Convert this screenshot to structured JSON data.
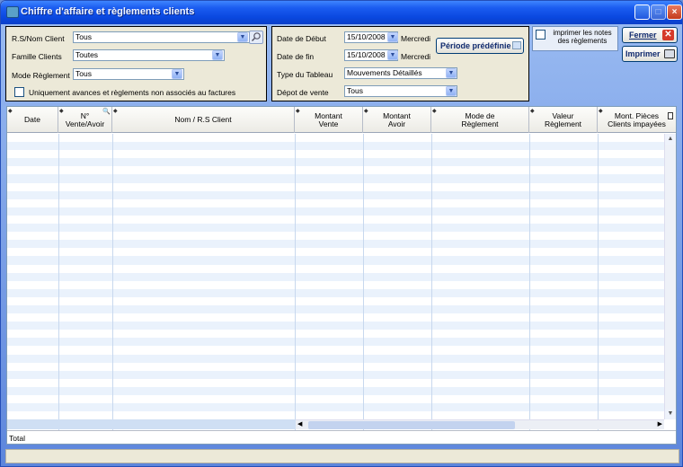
{
  "window": {
    "title": "Chiffre d'affaire et règlements clients"
  },
  "filters": {
    "client": {
      "label": "R.S/Nom  Client",
      "value": "Tous"
    },
    "famille": {
      "label": "Famille Clients",
      "value": "Toutes"
    },
    "mode": {
      "label": "Mode Règlement",
      "value": "Tous"
    },
    "uniquement": {
      "label": "Uniquement avances et règlements non associés au factures",
      "checked": false
    }
  },
  "period": {
    "debut": {
      "label": "Date de Début",
      "value": "15/10/2008",
      "day": "Mercredi"
    },
    "fin": {
      "label": "Date de fin",
      "value": "15/10/2008",
      "day": "Mercredi"
    },
    "preset_label": "Période prédéfinie",
    "type": {
      "label": "Type du Tableau",
      "value": "Mouvements Détaillés"
    },
    "depot": {
      "label": "Dépot de vente",
      "value": "Tous"
    }
  },
  "notes": {
    "label": "imprimer les notes des règlements",
    "checked": false
  },
  "actions": {
    "close": "Fermer",
    "print": "Imprimer"
  },
  "table": {
    "columns": [
      "Date",
      "N°\nVente/Avoir",
      "Nom / R.S  Client",
      "Montant\nVente",
      "Montant\nAvoir",
      "Mode de\nRèglement",
      "Valeur\nRèglement",
      "Mont. Pièces\nClients impayées"
    ],
    "total_label": "Total"
  },
  "icons": {
    "window": "app-icon",
    "search": "search-icon",
    "dropdown": "chevron-down-icon",
    "preset": "calendar-icon",
    "close": "close-x-icon",
    "print": "printer-icon"
  }
}
